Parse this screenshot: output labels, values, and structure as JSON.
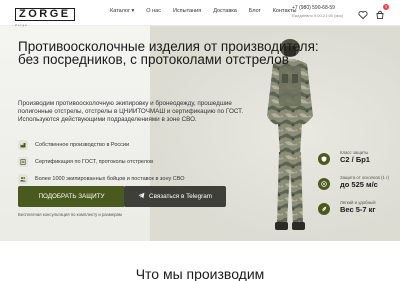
{
  "header": {
    "logo": "ZORGE",
    "logo_sub": "Zorge",
    "nav": [
      "Каталог",
      "О нас",
      "Испытания",
      "Доставка",
      "Блог",
      "Контакты"
    ],
    "phone": "+7 (980) 590-68-59",
    "hours": "Ежедневно 9:00-21:00 (мск)",
    "cart_count": "0",
    "icons": [
      "heart-icon",
      "cart-icon"
    ]
  },
  "hero": {
    "title": "Противоосколочные изделия от производителя: без посредников, с протоколами отстрелов",
    "lead": "Производим противоосколочную экипировку и бронеодежду, прошедшие полигонные отстрелы, отстрелы в ЦНИИТОЧМАШ и сертификацию по ГОСТ. Используются действующими подразделениями в зоне СВО.",
    "bullets": [
      {
        "icon": "factory-icon",
        "text": "Собственное производство в России"
      },
      {
        "icon": "certificate-icon",
        "text": "Сертификация по ГОСТ, протоколы отстрелов"
      },
      {
        "icon": "users-icon",
        "text": "Более 1000 экипированных бойцов и поставок в зону СВО"
      }
    ],
    "order_button": "ПОДОБРАТЬ ЗАЩИТУ",
    "telegram_button": "Связаться в Telegram",
    "consult_note": "Бесплатная консультация по комплекту и размерам",
    "specs": [
      {
        "label": "Класс защиты",
        "value": "С2 / Бр1"
      },
      {
        "label": "Защита от осколков (1 г)",
        "value": "до 525 м/с"
      },
      {
        "label": "Легкий и удобный",
        "value": "Вес 5-7 кг"
      }
    ]
  },
  "section": {
    "heading": "Что мы производим"
  },
  "colors": {
    "accent": "#4a5a1f",
    "dark_button": "#3f3f3a",
    "hero_bg": "#efefea"
  }
}
